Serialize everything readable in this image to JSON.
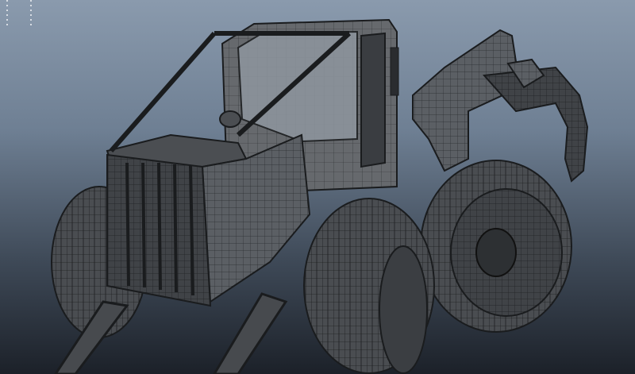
{
  "viewport": {
    "title": "",
    "subject": "forestry-skidder-wireframe-model"
  },
  "colors": {
    "bg_top": "#8a9aad",
    "bg_bottom": "#1c2129",
    "mesh_fill": "#5a5e63",
    "mesh_dark": "#3a3d41",
    "wire": "#1a1c1e"
  }
}
